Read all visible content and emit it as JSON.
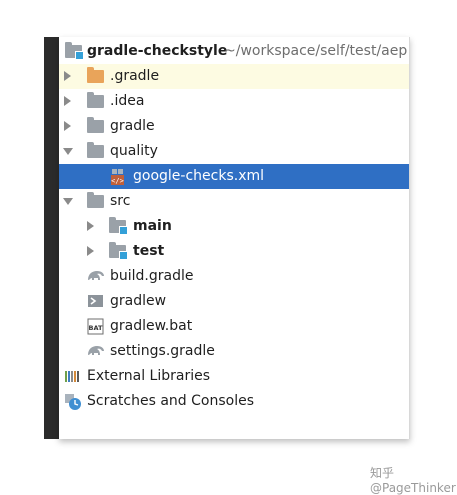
{
  "project": {
    "root_name": "gradle-checkstyle",
    "root_path": "~/workspace/self/test/aep"
  },
  "tree": [
    {
      "label": ".gradle"
    },
    {
      "label": ".idea"
    },
    {
      "label": "gradle"
    },
    {
      "label": "quality"
    },
    {
      "label": "google-checks.xml"
    },
    {
      "label": "src"
    },
    {
      "label": "main"
    },
    {
      "label": "test"
    },
    {
      "label": "build.gradle"
    },
    {
      "label": "gradlew"
    },
    {
      "label": "gradlew.bat"
    },
    {
      "label": "settings.gradle"
    },
    {
      "label": "External Libraries"
    },
    {
      "label": "Scratches and Consoles"
    }
  ],
  "colors": {
    "selection": "#2f6fc4",
    "highlight": "#fdfbe2",
    "folder": "#9aa1a8",
    "excluded_folder": "#e9a45a",
    "module_badge": "#34a0d8"
  },
  "watermark": "知乎 @PageThinker"
}
